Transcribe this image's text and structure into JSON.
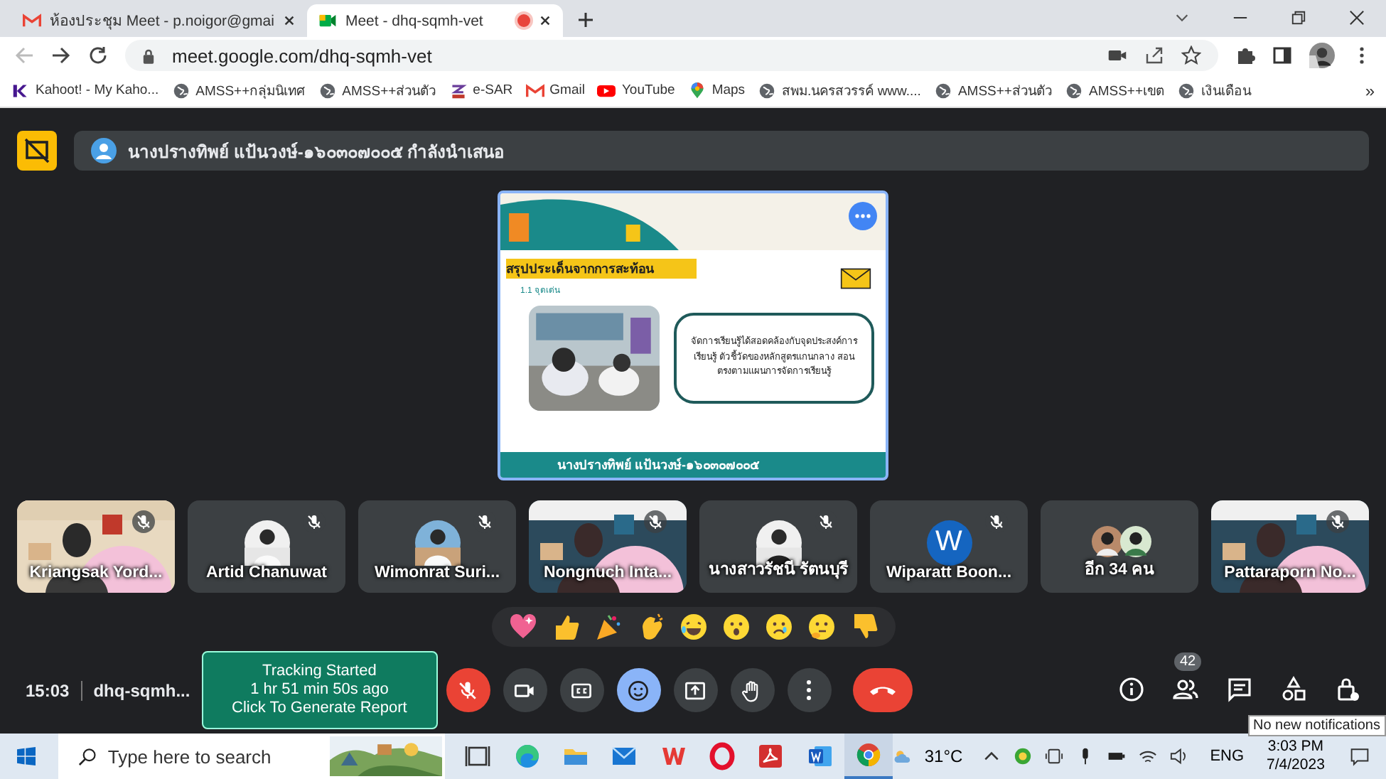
{
  "browser": {
    "tabs": [
      {
        "title": "ห้องประชุม Meet - p.noigor@gmai",
        "kind": "gmail",
        "selected": false,
        "recording": false
      },
      {
        "title": "Meet - dhq-sqmh-vet",
        "kind": "meet",
        "selected": true,
        "recording": true
      }
    ],
    "url": "meet.google.com/dhq-sqmh-vet",
    "bookmarks": [
      {
        "label": "Kahoot! - My Kaho...",
        "kind": "kahoot"
      },
      {
        "label": "AMSS++กลุ่มนิเทศ",
        "kind": "globe"
      },
      {
        "label": "AMSS++ส่วนตัว",
        "kind": "globe"
      },
      {
        "label": "e-SAR",
        "kind": "esar"
      },
      {
        "label": "Gmail",
        "kind": "gmail"
      },
      {
        "label": "YouTube",
        "kind": "youtube"
      },
      {
        "label": "Maps",
        "kind": "maps"
      },
      {
        "label": "สพม.นครสวรรค์ www....",
        "kind": "globe"
      },
      {
        "label": "AMSS++ส่วนตัว",
        "kind": "globe"
      },
      {
        "label": "AMSS++เขต",
        "kind": "globe"
      },
      {
        "label": "เงินเดือน",
        "kind": "globe"
      }
    ],
    "more_bookmarks": "»"
  },
  "meet": {
    "presenter_banner": "นางปรางทิพย์ แป้นวงษ์-๑๖๐๓๐๗๐๐๕ กำลังนำเสนอ",
    "slide": {
      "title": "สรุปประเด็นจากการสะท้อน",
      "subtitle": "1.1 จุดเด่น",
      "body": "จัดการเรียนรู้ได้สอดคล้องกับจุดประสงค์การเรียนรู้ ตัวชี้วัดของหลักสูตรแกนกลาง สอนตรงตามแผนการจัดการเรียนรู้",
      "caption": "นางปรางทิพย์ แป้นวงษ์-๑๖๐๓๐๗๐๐๕"
    },
    "tiles": [
      {
        "name": "Kriangsak Yord...",
        "kind": "video",
        "muted": true
      },
      {
        "name": "Artid Chanuwat",
        "muted": true
      },
      {
        "name": "Wimonrat Suri...",
        "muted": true
      },
      {
        "name": "Nongnuch Inta...",
        "kind": "video",
        "muted": true
      },
      {
        "name": "นางสาวรัชนี รัตนบุรี",
        "muted": true
      },
      {
        "name": "Wiparatt Boon...",
        "kind": "letter",
        "initial": "W",
        "muted": true
      },
      {
        "name": "อีก 34 คน",
        "kind": "more",
        "muted": false
      },
      {
        "name": "Pattaraporn No...",
        "kind": "video",
        "muted": true
      }
    ],
    "reactions": [
      {
        "kind": "heart"
      },
      {
        "kind": "thumbs_up"
      },
      {
        "kind": "party"
      },
      {
        "kind": "clap"
      },
      {
        "kind": "laugh"
      },
      {
        "kind": "wow"
      },
      {
        "kind": "sad"
      },
      {
        "kind": "think"
      },
      {
        "kind": "thumbs_down"
      }
    ],
    "meeting_time": "15:03",
    "meeting_code": "dhq-sqmh...",
    "tracking": [
      "Tracking Started",
      "1 hr 51 min 50s ago",
      "Click To Generate Report"
    ],
    "controls": [
      {
        "kind": "mic",
        "on": false
      },
      {
        "kind": "camera",
        "on": true
      },
      {
        "kind": "captions"
      },
      {
        "kind": "emoji",
        "active": true
      },
      {
        "kind": "present"
      },
      {
        "kind": "hand"
      },
      {
        "kind": "more"
      },
      {
        "kind": "end"
      }
    ],
    "side_buttons": [
      {
        "kind": "info"
      },
      {
        "kind": "people",
        "badge": "42"
      },
      {
        "kind": "chat"
      },
      {
        "kind": "activities"
      },
      {
        "kind": "host"
      }
    ],
    "tooltip": "No new notifications"
  },
  "taskbar": {
    "search_placeholder": "Type here to search",
    "apps": [
      {
        "kind": "taskview",
        "active": false
      },
      {
        "kind": "edge",
        "active": false
      },
      {
        "kind": "explorer",
        "active": false
      },
      {
        "kind": "mail",
        "active": false
      },
      {
        "kind": "wps",
        "active": false
      },
      {
        "kind": "opera",
        "active": false
      },
      {
        "kind": "acrobat",
        "active": false
      },
      {
        "kind": "word",
        "active": false
      },
      {
        "kind": "chrome",
        "active": true
      }
    ],
    "weather": "31°C",
    "language": "ENG",
    "time": "3:03 PM",
    "date": "7/4/2023"
  }
}
